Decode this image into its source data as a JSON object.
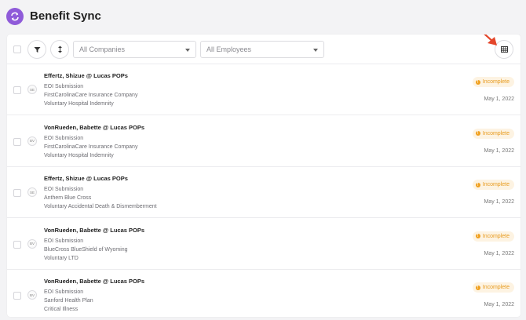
{
  "app": {
    "title": "Benefit Sync",
    "logo_icon": "sync-icon",
    "brand_color": "#8f5bd9"
  },
  "toolbar": {
    "filter_icon": "filter-icon",
    "sort_icon": "sort-icon",
    "company_select": {
      "value": "All Companies"
    },
    "employee_select": {
      "value": "All Employees"
    },
    "grid_view_icon": "table-view-icon"
  },
  "status_color": "#e79a1c",
  "rows": [
    {
      "initials": "SE",
      "title": "Effertz, Shizue @ Lucas POPs",
      "type": "EOI Submission",
      "carrier": "FirstCarolinaCare Insurance Company",
      "plan": "Voluntary Hospital Indemnity",
      "status": "Incomplete",
      "date": "May 1, 2022"
    },
    {
      "initials": "BV",
      "title": "VonRueden, Babette @ Lucas POPs",
      "type": "EOI Submission",
      "carrier": "FirstCarolinaCare Insurance Company",
      "plan": "Voluntary Hospital Indemnity",
      "status": "Incomplete",
      "date": "May 1, 2022"
    },
    {
      "initials": "SE",
      "title": "Effertz, Shizue @ Lucas POPs",
      "type": "EOI Submission",
      "carrier": "Anthem Blue Cross",
      "plan": "Voluntary Accidental Death & Dismemberment",
      "status": "Incomplete",
      "date": "May 1, 2022"
    },
    {
      "initials": "BV",
      "title": "VonRueden, Babette @ Lucas POPs",
      "type": "EOI Submission",
      "carrier": "BlueCross BlueShield of Wyoming",
      "plan": "Voluntary LTD",
      "status": "Incomplete",
      "date": "May 1, 2022"
    },
    {
      "initials": "BV",
      "title": "VonRueden, Babette @ Lucas POPs",
      "type": "EOI Submission",
      "carrier": "Sanford Health Plan",
      "plan": "Critical Illness",
      "status": "Incomplete",
      "date": "May 1, 2022"
    }
  ]
}
